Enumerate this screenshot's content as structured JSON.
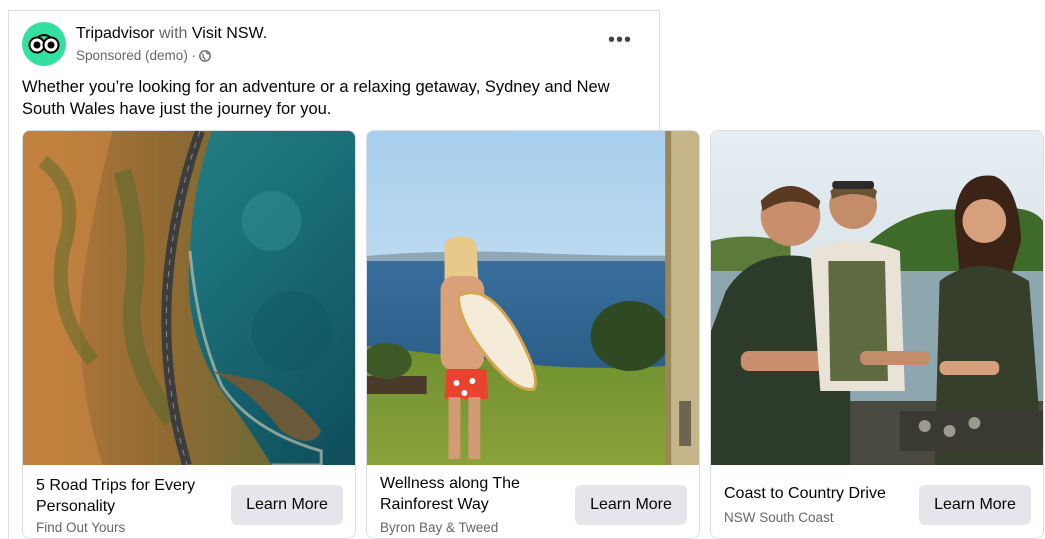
{
  "post": {
    "advertiser": "Tripadvisor",
    "with_word": "with",
    "partner": "Visit NSW.",
    "sponsored": "Sponsored (demo) ·",
    "caption": "Whether you’re looking for an adventure or a relaxing getaway, Sydney and New South Wales have just the journey for you."
  },
  "brand_color": "#34e0a1",
  "cards": [
    {
      "title": "5 Road Trips for Every Personality",
      "subtitle": "Find Out Yours",
      "cta": "Learn More",
      "image": "coastal-road-aerial-photo"
    },
    {
      "title": "Wellness along The Rainforest Way",
      "subtitle": "Byron Bay & Tweed",
      "cta": "Learn More",
      "image": "surfer-ocean-view-photo"
    },
    {
      "title": "Coast to Country Drive",
      "subtitle": "NSW South Coast",
      "cta": "Learn More",
      "image": "oyster-farmers-photo"
    }
  ]
}
